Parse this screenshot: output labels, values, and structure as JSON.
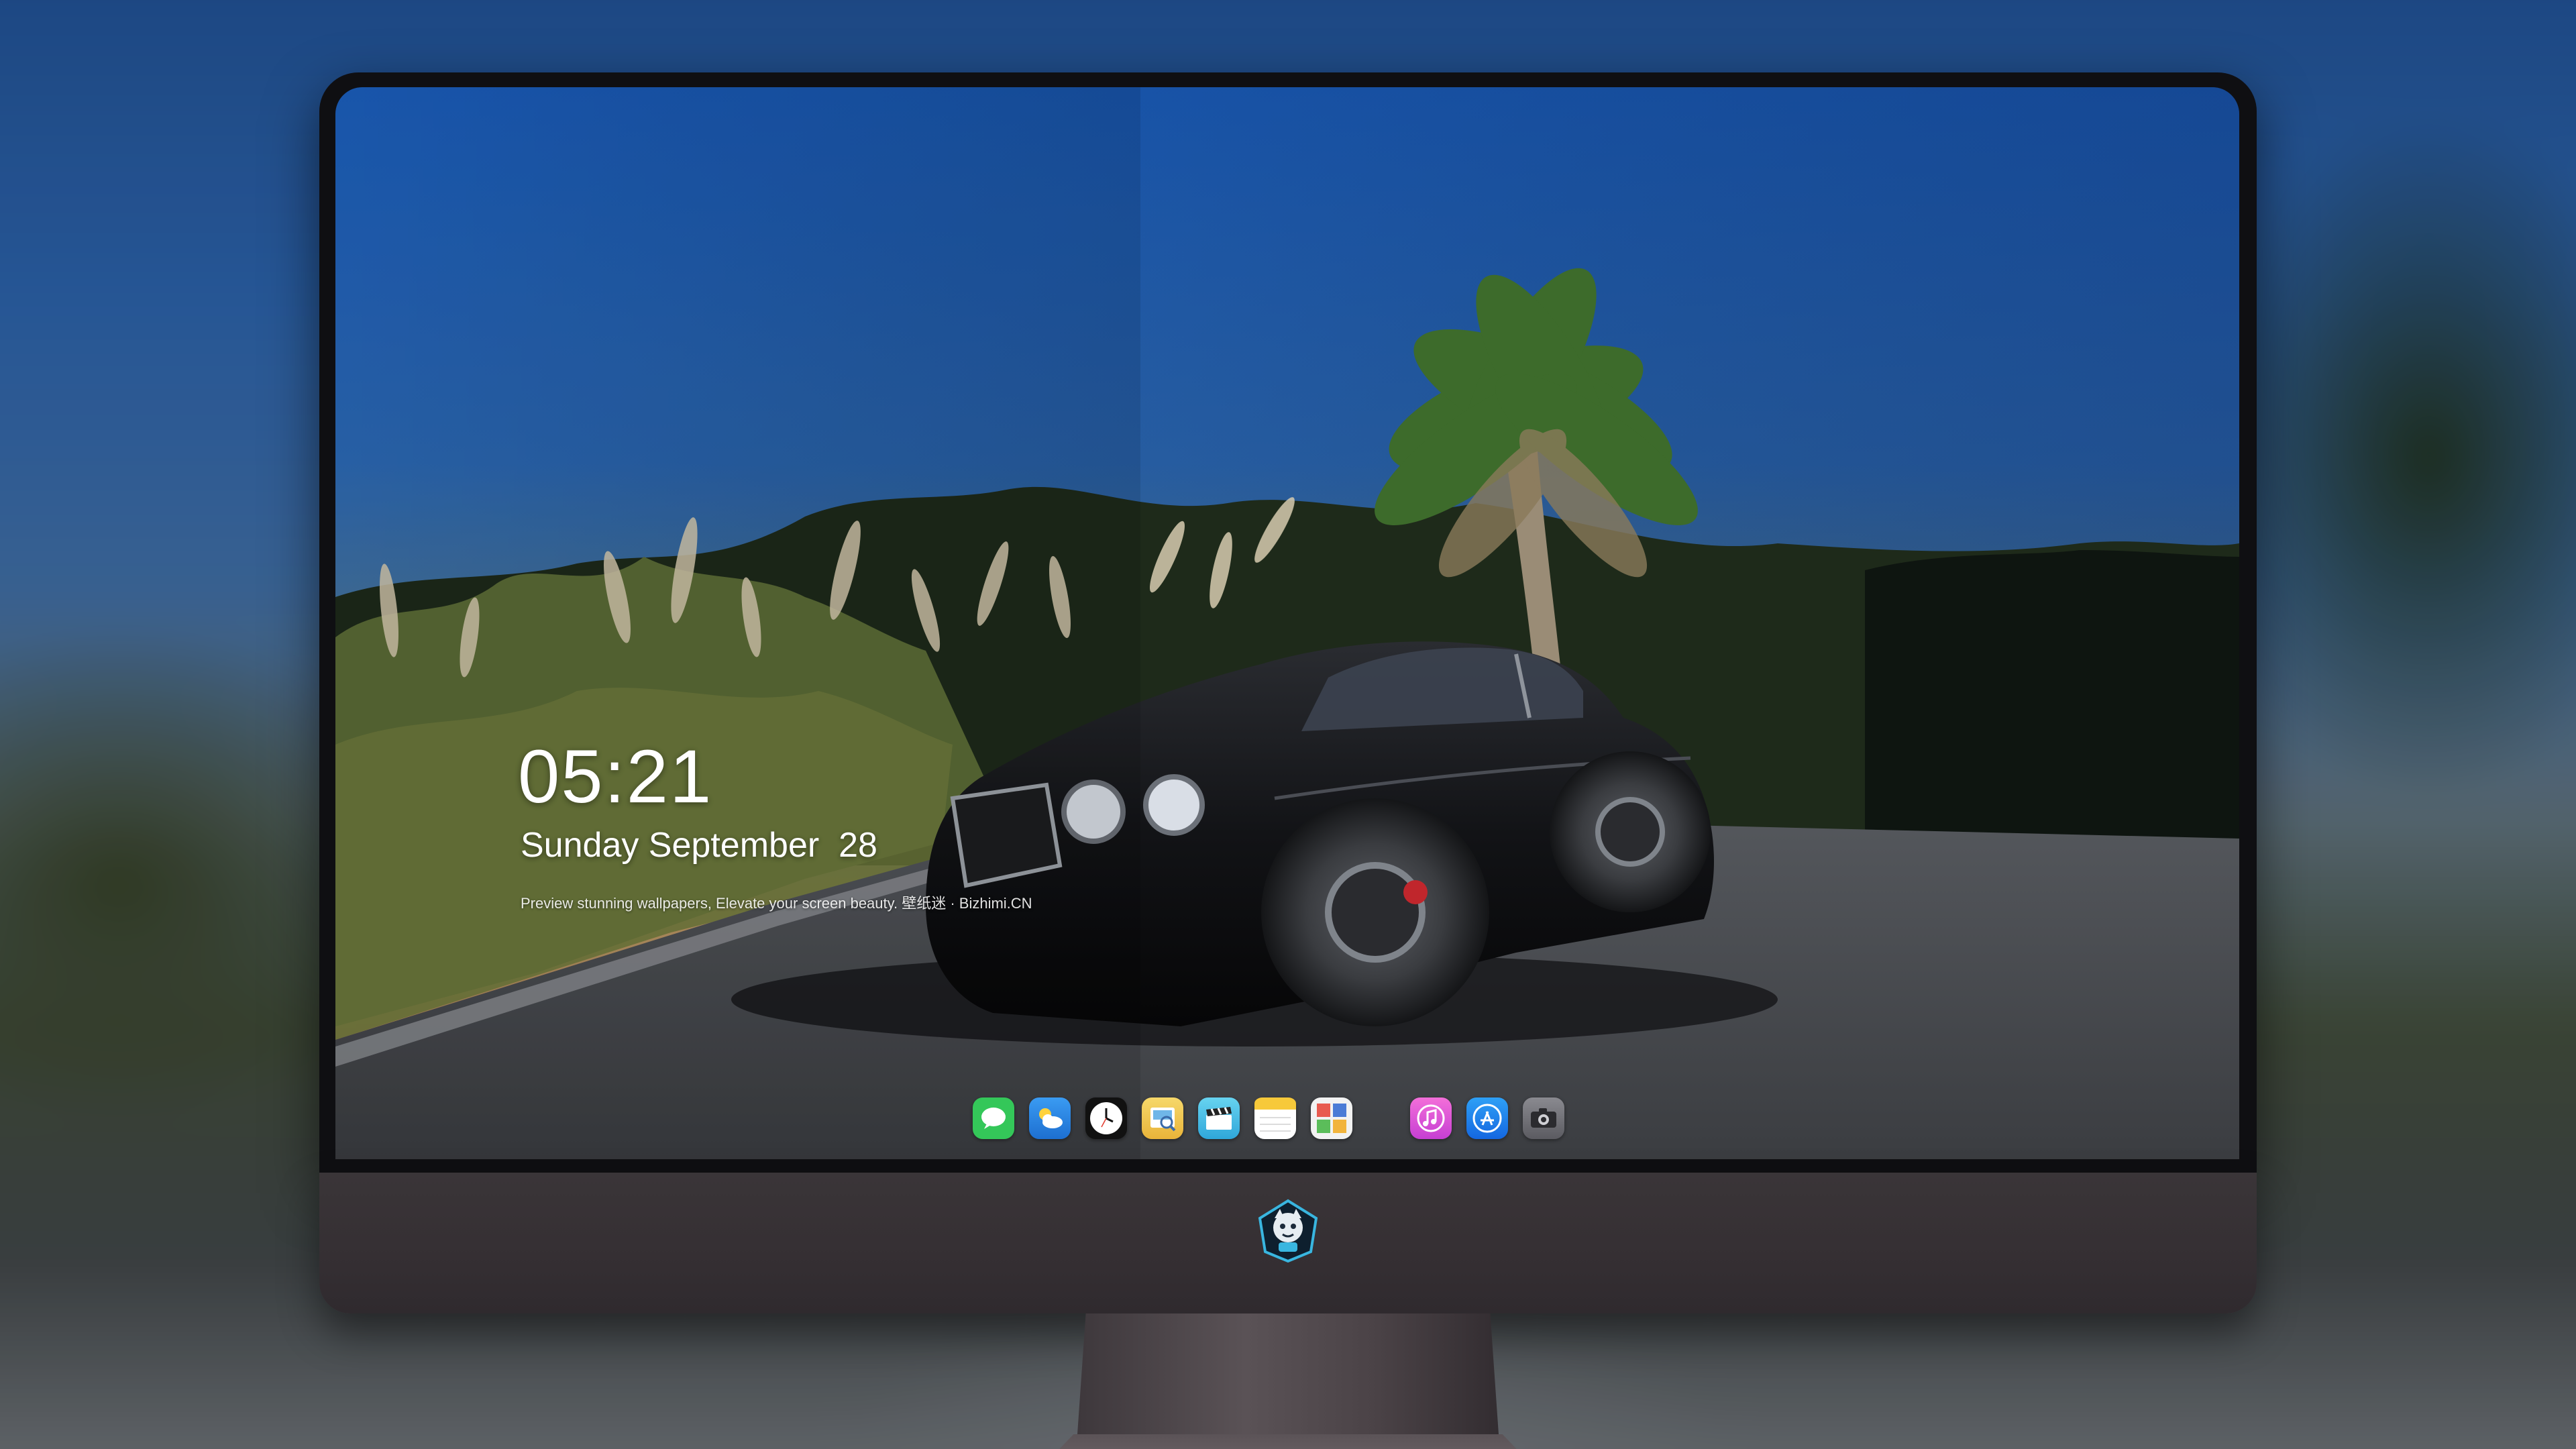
{
  "lockscreen": {
    "time": "05:21",
    "date": "Sunday September  28",
    "tagline": "Preview stunning wallpapers, Elevate your screen beauty. 壁纸迷 · Bizhimi.CN"
  },
  "dock": {
    "apps": [
      {
        "name": "Messages",
        "icon": "messages-icon",
        "color": "#34c759"
      },
      {
        "name": "Weather",
        "icon": "weather-icon",
        "color": "#2f86e8"
      },
      {
        "name": "Clock",
        "icon": "clock-icon",
        "color": "#111111"
      },
      {
        "name": "Preview",
        "icon": "preview-icon",
        "color": "#f2c74a"
      },
      {
        "name": "Clips",
        "icon": "clapperboard-icon",
        "color": "#4fc3e8"
      },
      {
        "name": "Notes",
        "icon": "notes-icon",
        "color": "#f7d23e"
      },
      {
        "name": "Photo Booth",
        "icon": "photo-booth-icon",
        "color": "#4a7bd6"
      },
      {
        "name": "iTunes",
        "icon": "music-note-icon",
        "color": "#e64fd6"
      },
      {
        "name": "App Store",
        "icon": "app-store-icon",
        "color": "#1e88f0"
      },
      {
        "name": "Camera",
        "icon": "camera-icon",
        "color": "#6e6e73"
      }
    ]
  },
  "brand": {
    "chin_logo": "robot-mascot-logo-icon"
  }
}
